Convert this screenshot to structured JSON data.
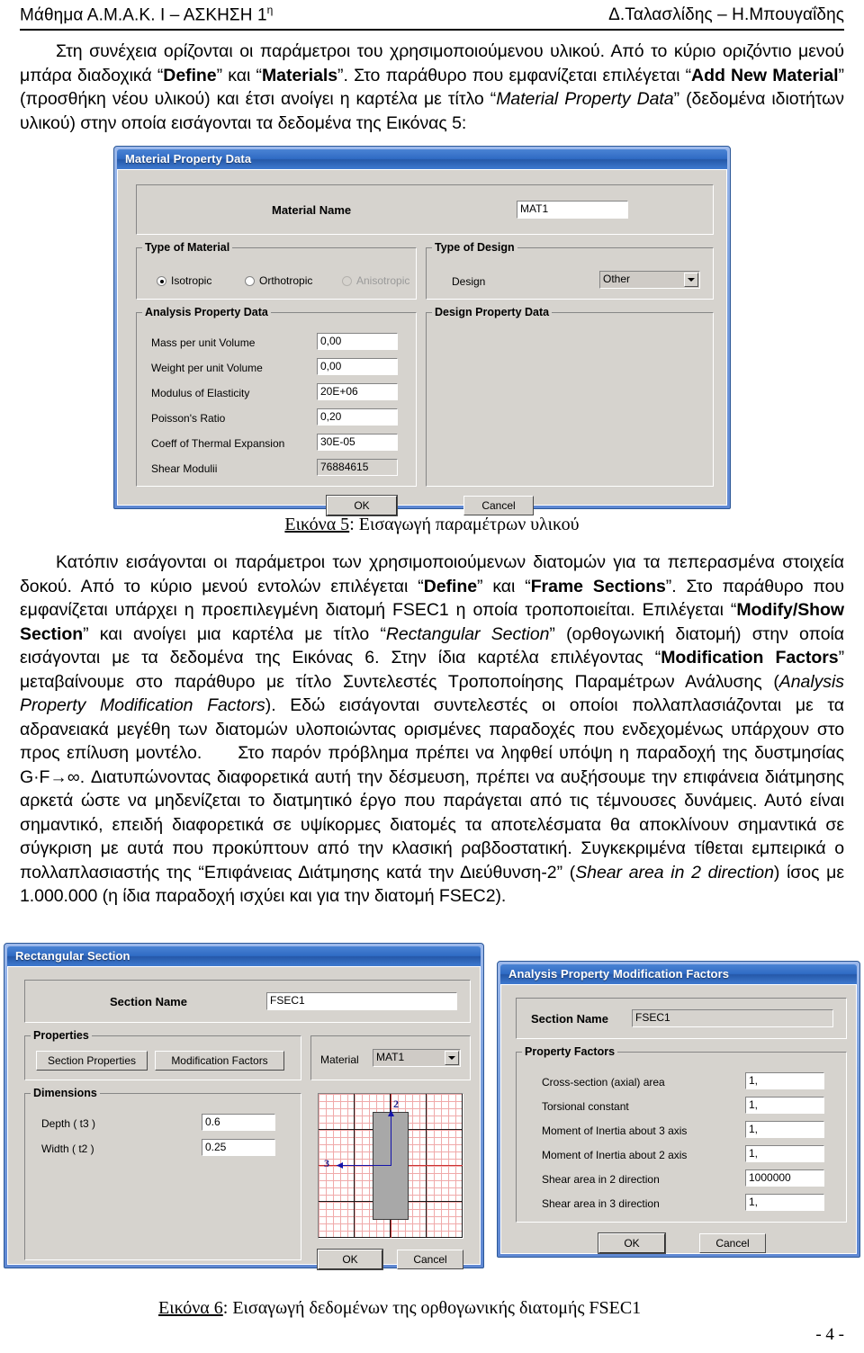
{
  "header": {
    "left": "Μάθημα Α.Μ.Α.Κ. Ι – ΑΣΚΗΣΗ 1",
    "left_sup": "η",
    "right": "Δ.Ταλασλίδης – Η.Μπουγαΐδης"
  },
  "paragraph_1": {
    "t1": "Στη συνέχεια ορίζονται οι παράμετροι του χρησιμοποιούμενου υλικού. Από το κύριο οριζόντιο μενού μπάρα διαδοχικά “",
    "b1": "Define",
    "t2": "” και “",
    "b2": "Materials",
    "t3": "”. Στο παράθυρο που εμφανίζεται επιλέγεται “",
    "b3": "Add New Material",
    "t4": "” (προσθήκη νέου υλικού) και έτσι ανοίγει η καρτέλα με τίτλο “",
    "i1": "Material Property Data",
    "t5": "” (δεδομένα ιδιοτήτων υλικού) στην οποία εισάγονται τα δεδομένα της Εικόνας 5:"
  },
  "paragraph_2": {
    "t1": "Κατόπιν εισάγονται οι παράμετροι των χρησιμοποιούμενων διατομών για τα πεπερασμένα στοιχεία δοκού. Από το κύριο μενού εντολών επιλέγεται “",
    "b1": "Define",
    "t2": "” και “",
    "b2": "Frame Sections",
    "t3": "”. Στο παράθυρο που εμφανίζεται υπάρχει η προεπιλεγμένη διατομή FSEC1 η οποία τροποποιείται. Επιλέγεται “",
    "b3": "Modify/Show Section",
    "t4": "” και ανοίγει μια καρτέλα με τίτλο “",
    "i1": "Rectangular Section",
    "t5": "” (ορθογωνική διατομή) στην οποία εισάγονται με τα δεδομένα της Εικόνας 6. Στην ίδια καρτέλα επιλέγοντας “",
    "b4": "Modification Factors",
    "t6": "” μεταβαίνουμε στο παράθυρο με τίτλο Συντελεστές Τροποποίησης Παραμέτρων Ανάλυσης (",
    "i2": "Analysis Property Modification Factors",
    "t7": "). Εδώ εισάγονται συντελεστές οι οποίοι πολλαπλασιάζονται με τα αδρανειακά μεγέθη των διατομών υλοποιώντας ορισμένες παραδοχές που ενδεχομένως υπάρχουν στο προς επίλυση μοντέλο.",
    "t8": "Στο παρόν πρόβλημα πρέπει να ληφθεί υπόψη η παραδοχή της δυστμησίας G·F→∞. Διατυπώνοντας διαφορετικά αυτή την δέσμευση, πρέπει να αυξήσουμε την επιφάνεια διάτμησης αρκετά ώστε να μηδενίζεται το διατμητικό έργο που παράγεται από τις τέμνουσες δυνάμεις. Αυτό είναι σημαντικό, επειδή διαφορετικά σε υψίκορμες διατομές τα αποτελέσματα θα αποκλίνουν σημαντικά σε σύγκριση με αυτά που προκύπτουν από την κλασική ραβδοστατική. Συγκεκριμένα τίθεται εμπειρικά ο πολλαπλασιαστής της “Επιφάνειας Διάτμησης κατά την Διεύθυνση-2” (",
    "i3": "Shear area in 2 direction",
    "t9": ") ίσος με 1.000.000 (η ίδια παραδοχή ισχύει και για την διατομή FSEC2)."
  },
  "caption_5": {
    "num": "Εικόνα 5",
    "text": ": Εισαγωγή παραμέτρων υλικού"
  },
  "caption_6": {
    "num": "Εικόνα 6",
    "text": ": Εισαγωγή δεδομένων της ορθογωνικής διατομής FSEC1"
  },
  "page_number": "- 4 -",
  "material_property_dialog": {
    "title": "Material Property Data",
    "material_name_label": "Material Name",
    "material_name_value": "MAT1",
    "type_of_material": {
      "group_title": "Type of Material",
      "options": [
        {
          "label": "Isotropic",
          "checked": true,
          "disabled": false
        },
        {
          "label": "Orthotropic",
          "checked": false,
          "disabled": false
        },
        {
          "label": "Anisotropic",
          "checked": false,
          "disabled": true
        }
      ]
    },
    "type_of_design": {
      "group_title": "Type of Design",
      "design_label": "Design",
      "design_value": "Other"
    },
    "analysis_property_data": {
      "group_title": "Analysis Property Data",
      "rows": [
        {
          "label": "Mass per unit Volume",
          "value": "0,00"
        },
        {
          "label": "Weight per unit Volume",
          "value": "0,00"
        },
        {
          "label": "Modulus of Elasticity",
          "value": "20E+06"
        },
        {
          "label": "Poisson's Ratio",
          "value": "0,20"
        },
        {
          "label": "Coeff of Thermal Expansion",
          "value": "30E-05"
        },
        {
          "label": "Shear Modulii",
          "value": "76884615"
        }
      ]
    },
    "design_property_data": {
      "group_title": "Design Property Data"
    },
    "ok_label": "OK",
    "cancel_label": "Cancel"
  },
  "rectangular_section_dialog": {
    "title": "Rectangular Section",
    "section_name_label": "Section Name",
    "section_name_value": "FSEC1",
    "properties": {
      "group_title": "Properties",
      "section_properties_label": "Section Properties",
      "modification_factors_label": "Modification Factors"
    },
    "material": {
      "label": "Material",
      "value": "MAT1"
    },
    "dimensions": {
      "group_title": "Dimensions",
      "rows": [
        {
          "label": "Depth  ( t3 )",
          "value": "0.6"
        },
        {
          "label": "Width  ( t2 )",
          "value": "0.25"
        }
      ]
    },
    "preview": {
      "axis_2_label": "2",
      "axis_3_label": "3"
    },
    "ok_label": "OK",
    "cancel_label": "Cancel"
  },
  "modification_factors_dialog": {
    "title": "Analysis Property Modification Factors",
    "section_name_label": "Section Name",
    "section_name_value": "FSEC1",
    "property_factors": {
      "group_title": "Property Factors",
      "rows": [
        {
          "label": "Cross-section (axial) area",
          "value": "1,"
        },
        {
          "label": "Torsional constant",
          "value": "1,"
        },
        {
          "label": "Moment of Inertia about 3 axis",
          "value": "1,"
        },
        {
          "label": "Moment of Inertia about 2 axis",
          "value": "1,"
        },
        {
          "label": "Shear area in 2 direction",
          "value": "1000000"
        },
        {
          "label": "Shear area in 3 direction",
          "value": "1,"
        }
      ]
    },
    "ok_label": "OK",
    "cancel_label": "Cancel"
  }
}
